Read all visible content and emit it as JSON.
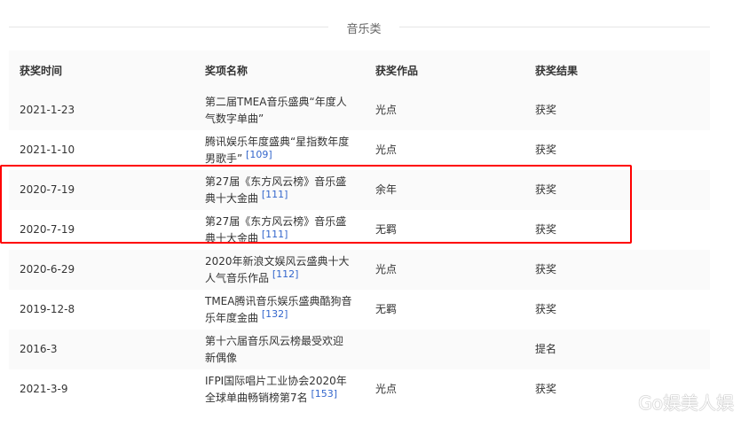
{
  "section_title": "音乐类",
  "headers": [
    "获奖时间",
    "奖项名称",
    "获奖作品",
    "获奖结果"
  ],
  "rows": [
    {
      "date": "2021-1-23",
      "award": "第二届TMEA音乐盛典“年度人气数字单曲”",
      "ref": "",
      "work": "光点",
      "result": "获奖"
    },
    {
      "date": "2021-1-10",
      "award": "腾讯娱乐年度盛典“星指数年度男歌手”",
      "ref": "[109]",
      "work": "光点",
      "result": "获奖"
    },
    {
      "date": "2020-7-19",
      "award": "第27届《东方风云榜》音乐盛典十大金曲",
      "ref": "[111]",
      "work": "余年",
      "result": "获奖"
    },
    {
      "date": "2020-7-19",
      "award": "第27届《东方风云榜》音乐盛典十大金曲",
      "ref": "[111]",
      "work": "无羁",
      "result": "获奖"
    },
    {
      "date": "2020-6-29",
      "award": "2020年新浪文娱风云盛典十大人气音乐作品",
      "ref": "[112]",
      "work": "光点",
      "result": "获奖"
    },
    {
      "date": "2019-12-8",
      "award": "TMEA腾讯音乐娱乐盛典酷狗音乐年度金曲",
      "ref": "[132]",
      "work": "无羁",
      "result": "获奖"
    },
    {
      "date": "2016-3",
      "award": "第十六届音乐风云榜最受欢迎新偶像",
      "ref": "",
      "work": "",
      "result": "提名"
    },
    {
      "date": "2021-3-9",
      "award": "IFPI国际唱片工业协会2020年全球单曲畅销榜第7名",
      "ref": "[153]",
      "work": "光点",
      "result": "获奖"
    }
  ],
  "watermark": "Go娱美人娱"
}
